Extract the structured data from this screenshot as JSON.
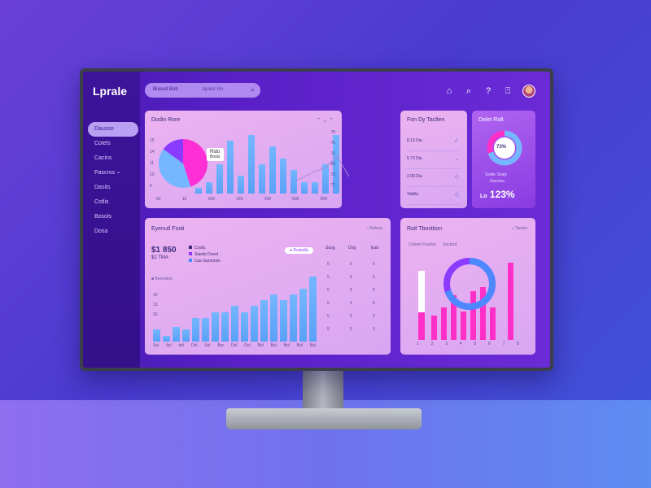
{
  "app": {
    "name": "Lprale"
  },
  "search": {
    "placeholder": "Biased Bob",
    "hint": "Apaist Ho",
    "icon": "search-icon"
  },
  "header_icons": [
    "home-icon",
    "search-icon",
    "help-icon",
    "notifications-icon"
  ],
  "sidebar": {
    "items": [
      {
        "label": "Dausso",
        "active": true
      },
      {
        "label": "Cotels"
      },
      {
        "label": "Cacins"
      },
      {
        "label": "Pascros ∘"
      },
      {
        "label": "Dasits"
      },
      {
        "label": "Cotlis"
      },
      {
        "label": "Bosols"
      },
      {
        "label": "Dosa"
      }
    ]
  },
  "cards": {
    "c1": {
      "title": "Dodin Rore",
      "tooltip_a": "Rido",
      "tooltip_b": "Bosts",
      "y_ticks": [
        "15",
        "14",
        "11",
        "10",
        "5"
      ],
      "x_ticks": [
        "50",
        "10",
        "100",
        "100",
        "100",
        "500",
        "500"
      ],
      "right_ticks": [
        "78",
        "75",
        "10",
        "80",
        "72",
        "71"
      ],
      "bars": [
        1,
        2,
        5,
        9,
        3,
        10,
        5,
        8,
        6,
        4,
        2,
        2,
        5,
        10
      ],
      "pie": [
        {
          "color": "#ff2fd6",
          "value": 45
        },
        {
          "color": "#74b6ff",
          "value": 40
        },
        {
          "color": "#8b3bff",
          "value": 15
        }
      ]
    },
    "c2": {
      "title": "Fon Dy Taclten",
      "rows": [
        {
          "label": "8.13 Diu"
        },
        {
          "label": "5.73 Diu"
        },
        {
          "label": "2.09 Diu"
        },
        {
          "label": "Toblits"
        }
      ]
    },
    "c3": {
      "title": "Delet Rolt",
      "donut_label": "73%",
      "sub1": "Sodte Soaly",
      "sub2": "Garctea",
      "percent": "123%",
      "percent_prefix": "Lo"
    },
    "c4": {
      "title": "Eyenutl Fosti",
      "hint": "Rotoris",
      "big_value": "$1 850",
      "sub_value": "$1 TMA",
      "legend": [
        "Cosilc",
        "Siasits Dosot",
        "Cas Ganonsts"
      ],
      "chip": "Roisinlle",
      "section_label": "Bresodoo",
      "table_headers": [
        "Suog",
        "Dog",
        "Ead"
      ],
      "table_rows": [
        [
          "5",
          "5",
          "5"
        ],
        [
          "5",
          "5",
          "5"
        ],
        [
          "5",
          "5",
          "5"
        ],
        [
          "5",
          "5",
          "5"
        ],
        [
          "5",
          "5",
          "5"
        ],
        [
          "5",
          "5",
          "5"
        ]
      ],
      "bars": [
        2,
        1,
        2.5,
        2,
        4,
        4,
        5,
        5,
        6,
        5,
        6,
        7,
        8,
        7,
        8,
        9,
        11
      ],
      "x_ticks": [
        "Sol",
        "4ol",
        "dol",
        "Dol",
        "Sol",
        "Bar",
        "Dol",
        "Dol",
        "Bol",
        "Bol",
        "Bol",
        "Bol",
        "Bol"
      ],
      "y_ticks": [
        "10",
        "13",
        "20"
      ]
    },
    "c5": {
      "title": "Rotl Tbosttion",
      "hint": "Tamon",
      "legend_a": "Cotiom Fosolor",
      "legend_b": "Sectord",
      "left_bar": 0.85,
      "pink_bars": [
        0.3,
        0.4,
        0.55,
        0.35,
        0.6,
        0.65,
        0.4,
        0.95
      ],
      "x_ticks": [
        "1",
        "2",
        "3",
        "4",
        "5",
        "6",
        "7",
        "8"
      ],
      "donut": [
        {
          "color": "#4e88ff",
          "value": 70
        },
        {
          "color": "#8b3bff",
          "value": 30
        }
      ]
    }
  },
  "colors": {
    "accent": "#6a2bd6",
    "pink": "#ff2fc7",
    "blue": "#74b6ff"
  }
}
